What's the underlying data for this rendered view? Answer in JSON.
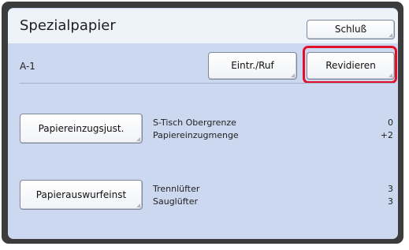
{
  "header": {
    "title": "Spezialpapier",
    "exit_label": "Schluß"
  },
  "preset": {
    "name": "A-1",
    "entry_call_label": "Eintr./Ruf",
    "revise_label": "Revidieren"
  },
  "feed_section": {
    "button_label": "Papiereinzugsjust.",
    "rows": [
      {
        "label": "S-Tisch Obergrenze",
        "value": "0"
      },
      {
        "label": "Papiereinzugmenge",
        "value": "+2"
      }
    ]
  },
  "output_section": {
    "button_label": "Papierauswurfeinst",
    "rows": [
      {
        "label": "Trennlüfter",
        "value": "3"
      },
      {
        "label": "Sauglüfter",
        "value": "3"
      }
    ]
  },
  "colors": {
    "panel_background": "#cbd8ef",
    "highlight": "#e2112a"
  }
}
